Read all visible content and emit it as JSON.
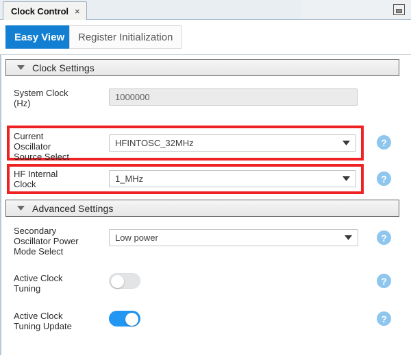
{
  "window": {
    "tab_title": "Clock Control",
    "close_label": "×",
    "minimize_icon": "minimize-icon"
  },
  "view_tabs": [
    {
      "label": "Easy View",
      "active": true
    },
    {
      "label": "Register Initialization",
      "active": false
    }
  ],
  "sections": [
    {
      "title": "Clock Settings",
      "expanded": true,
      "caret_icon": "caret-down-icon"
    },
    {
      "title": "Advanced Settings",
      "expanded": true,
      "caret_icon": "caret-down-icon"
    }
  ],
  "fields": {
    "system_clock": {
      "label": "System Clock\n(Hz)",
      "label_line1": "System Clock",
      "label_line2": "(Hz)",
      "value": "1000000",
      "type": "textbox",
      "disabled": true,
      "highlighted": false,
      "has_help": false
    },
    "current_oscillator": {
      "label_line1": "Current",
      "label_line2": "Oscillator",
      "label_line3": "Source Select",
      "value": "HFINTOSC_32MHz",
      "type": "combobox",
      "disabled": false,
      "highlighted": true,
      "has_help": true
    },
    "hf_internal_clock": {
      "label_line1": "HF Internal",
      "label_line2": "Clock",
      "value": "1_MHz",
      "type": "combobox",
      "disabled": false,
      "highlighted": true,
      "has_help": true
    },
    "secondary_osc_power": {
      "label_line1": "Secondary",
      "label_line2": "Oscillator Power",
      "label_line3": "Mode Select",
      "value": "Low power",
      "type": "combobox",
      "disabled": false,
      "highlighted": false,
      "has_help": true
    },
    "active_clock_tuning": {
      "label_line1": "Active Clock",
      "label_line2": "Tuning",
      "value": "off",
      "type": "toggle",
      "has_help": true
    },
    "active_clock_tuning_update": {
      "label_line1": "Active Clock",
      "label_line2": "Tuning Update",
      "value": "on",
      "type": "toggle",
      "has_help": true
    }
  },
  "help_icon_glyph": "?",
  "colors": {
    "accent_blue": "#127fd2",
    "toggle_on": "#2196f3",
    "highlight_red": "#ee2222",
    "help_blue": "#8ec6ee"
  }
}
